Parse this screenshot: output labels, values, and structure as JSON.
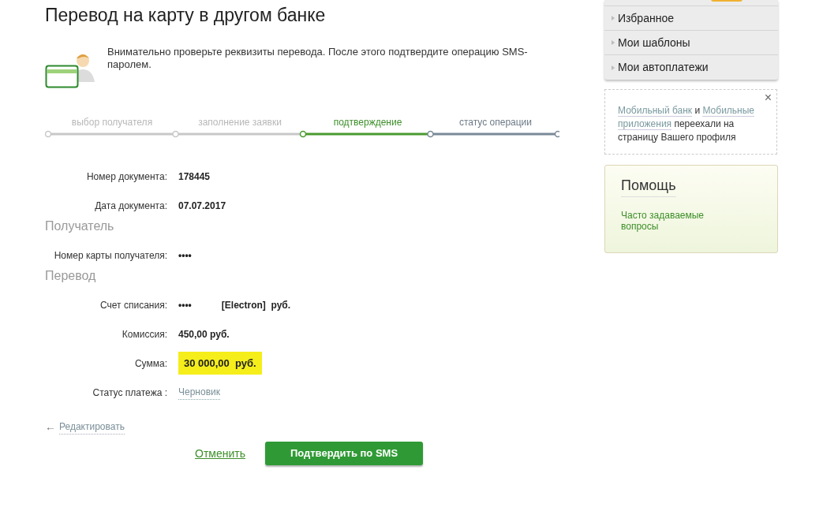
{
  "title": "Перевод на карту в другом банке",
  "notice": "Внимательно проверьте реквизиты перевода. После этого подтвердите операцию SMS-паролем.",
  "steps": [
    {
      "label": "выбор получателя",
      "done": true,
      "selected": false
    },
    {
      "label": "заполнение заявки",
      "done": true,
      "selected": false
    },
    {
      "label": "подтверждение",
      "done": false,
      "selected": true
    },
    {
      "label": "статус операции",
      "done": false,
      "selected": false
    }
  ],
  "sections": [
    {
      "rows": [
        {
          "label": "Номер документа:",
          "value": "178445",
          "kind": "plain"
        },
        {
          "label": "Дата документа:",
          "value": "07.07.2017",
          "kind": "plain"
        }
      ]
    },
    {
      "heading": "Получатель",
      "rows": [
        {
          "label": "Номер карты получателя:",
          "value": "••••",
          "kind": "plain"
        }
      ]
    },
    {
      "heading": "Перевод",
      "rows": [
        {
          "label": "Счет списания:",
          "value": "••••",
          "suffix": "[Electron]  руб.",
          "kind": "account"
        },
        {
          "label": "Комиссия:",
          "value": "450,00 руб.",
          "kind": "plain"
        },
        {
          "label": "Сумма:",
          "value": "30 000,00  руб.",
          "kind": "highlight"
        },
        {
          "label": "Статус платежа :",
          "value": "Черновик",
          "kind": "link"
        }
      ]
    }
  ],
  "edit_link": {
    "arrow": "←",
    "label": "Редактировать"
  },
  "actions": {
    "cancel": "Отменить",
    "confirm": "Подтвердить по SMS"
  },
  "sidebar": {
    "menu": [
      {
        "label": "Избранное"
      },
      {
        "label": "Мои шаблоны"
      },
      {
        "label": "Мои автоплатежи"
      }
    ],
    "notice": {
      "close": "×",
      "link1": "Мобильный банк",
      "and": "и",
      "link2": [
        "Мобильные",
        "приложения"
      ],
      "text": "переехали на страницу Вашего профиля"
    },
    "help": {
      "title": "Помощь",
      "links": [
        "Часто задаваемые вопросы"
      ]
    }
  }
}
